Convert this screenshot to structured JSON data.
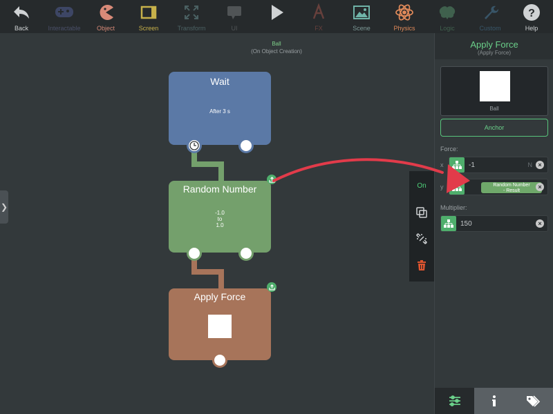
{
  "toolbar": {
    "back": "Back",
    "interactable": "Interactable",
    "object": "Object",
    "screen": "Screen",
    "transform": "Transform",
    "ui": "UI",
    "fx": "FX",
    "scene": "Scene",
    "physics": "Physics",
    "logic": "Logic",
    "custom": "Custom",
    "help": "Help"
  },
  "canvas": {
    "object_name": "Ball",
    "trigger": "(On Object Creation)"
  },
  "blocks": {
    "wait": {
      "title": "Wait",
      "detail": "After 3 s"
    },
    "random": {
      "title": "Random Number",
      "line1": "-1.0",
      "line2": "to",
      "line3": "1.0"
    },
    "apply": {
      "title": "Apply Force"
    }
  },
  "context_menu": {
    "on_label": "On"
  },
  "panel": {
    "title": "Apply Force",
    "subtitle": "(Apply Force)",
    "object_name": "Ball",
    "anchor_label": "Anchor",
    "force_label": "Force:",
    "x_axis": "x",
    "x_value": "-1",
    "x_unit": "N",
    "y_axis": "y",
    "y_chip_line1": "Random Number",
    "y_chip_line2": "- Result",
    "multiplier_label": "Multiplier:",
    "multiplier_value": "150"
  },
  "colors": {
    "accent": "#6bd08a",
    "wait_block": "#5b79a6",
    "random_block": "#74a06c",
    "apply_block": "#a7745a",
    "arrow": "#e23b4a",
    "delete": "#e0552f"
  }
}
